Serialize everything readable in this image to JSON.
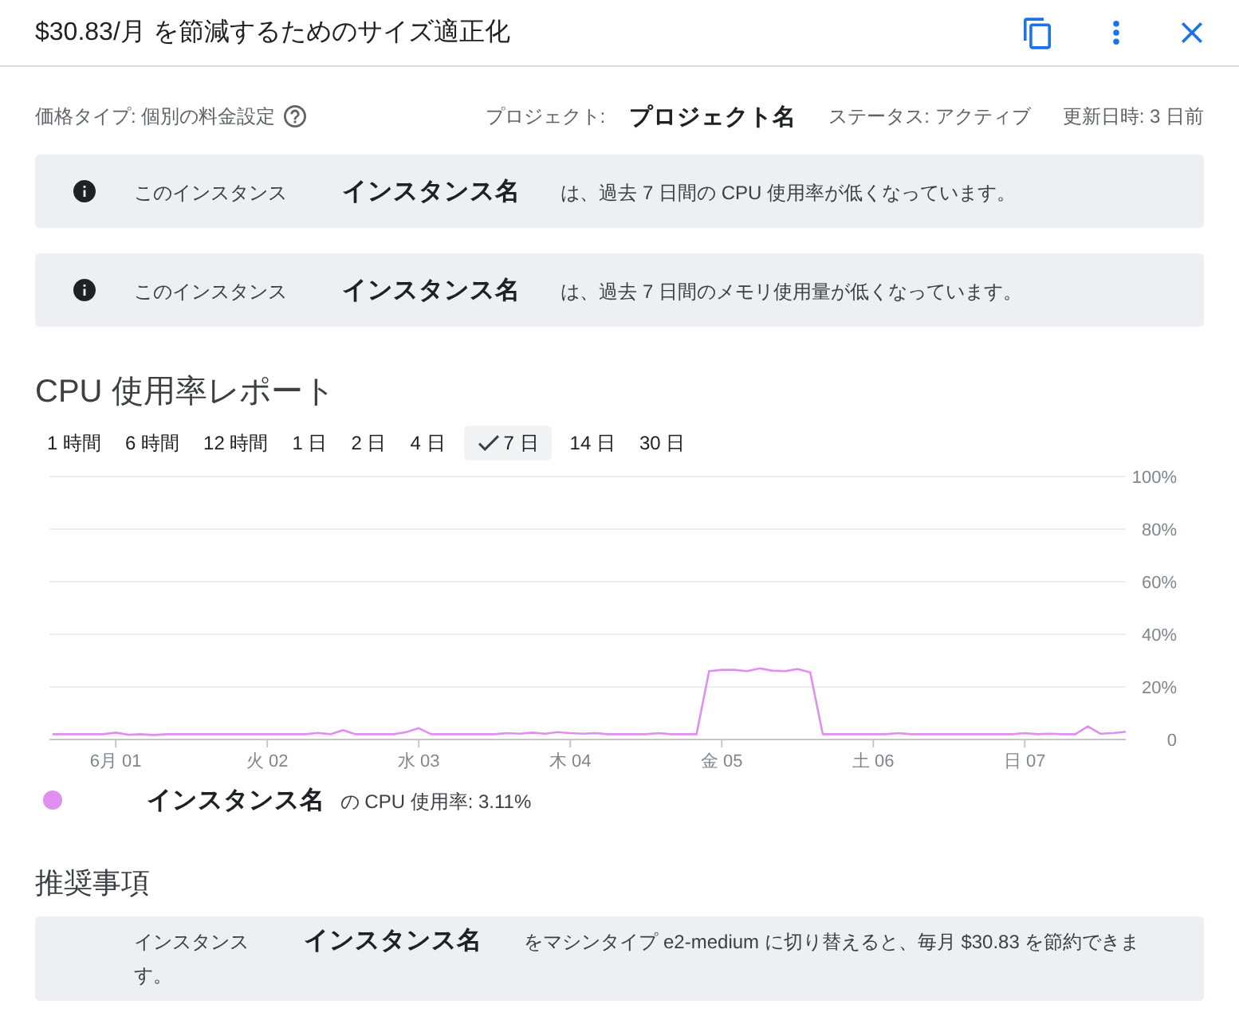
{
  "header": {
    "title": "$30.83/月 を節減するためのサイズ適正化"
  },
  "meta": {
    "pricing_type": "価格タイプ: 個別の料金設定",
    "project_label": "プロジェクト:",
    "project_name": "プロジェクト名",
    "status": "ステータス: アクティブ",
    "updated": "更新日時: 3 日前"
  },
  "alerts": [
    {
      "text": "このインスタンス **インスタンス名** は、過去 7 日間の CPU 使用率が低くなっています。"
    },
    {
      "text": "このインスタンス **インスタンス名** は、過去 7 日間のメモリ使用量が低くなっています。"
    }
  ],
  "cpu_report": {
    "title": "CPU 使用率レポート",
    "ranges": [
      {
        "label": "1 時間",
        "selected": false
      },
      {
        "label": "6 時間",
        "selected": false
      },
      {
        "label": "12 時間",
        "selected": false
      },
      {
        "label": "1 日",
        "selected": false
      },
      {
        "label": "2 日",
        "selected": false
      },
      {
        "label": "4 日",
        "selected": false
      },
      {
        "label": "7 日",
        "selected": true
      },
      {
        "label": "14 日",
        "selected": false
      },
      {
        "label": "30 日",
        "selected": false
      }
    ],
    "chart_data": {
      "type": "line",
      "categories": [
        null,
        null,
        null,
        null,
        null,
        "6月 01",
        null,
        null,
        null,
        null,
        null,
        null,
        null,
        null,
        null,
        null,
        null,
        "火 02",
        null,
        null,
        null,
        null,
        null,
        null,
        null,
        null,
        null,
        null,
        null,
        "水 03",
        null,
        null,
        null,
        null,
        null,
        null,
        null,
        null,
        null,
        null,
        null,
        "木 04",
        null,
        null,
        null,
        null,
        null,
        null,
        null,
        null,
        null,
        null,
        null,
        "金 05",
        null,
        null,
        null,
        null,
        null,
        null,
        null,
        null,
        null,
        null,
        null,
        "土 06",
        null,
        null,
        null,
        null,
        null,
        null,
        null,
        null,
        null,
        null,
        null,
        "日 07",
        null,
        null,
        null,
        null,
        null,
        null,
        null,
        null
      ],
      "series": [
        {
          "name": "インスタンス名",
          "color": "#e08ef0",
          "values": [
            2,
            2,
            2,
            2,
            2,
            2.6,
            1.8,
            2,
            1.7,
            2,
            2,
            2,
            2,
            2,
            2,
            2,
            2,
            2,
            2,
            2,
            2,
            2.5,
            2,
            3.6,
            2,
            2,
            2,
            2,
            2.8,
            4.3,
            2,
            2,
            2,
            2,
            2,
            2,
            2.4,
            2.2,
            2.6,
            2.2,
            2.8,
            2.4,
            2.2,
            2.4,
            2,
            2,
            2,
            2,
            2.4,
            2,
            2,
            2,
            26,
            26.5,
            26.5,
            26,
            27,
            26.2,
            26,
            26.8,
            25.5,
            2,
            2,
            2,
            2,
            2,
            2,
            2.4,
            2,
            2,
            2,
            2,
            2,
            2,
            2,
            2,
            2,
            2.4,
            2,
            2.2,
            2,
            2,
            5,
            2.2,
            2.4,
            3
          ]
        }
      ],
      "ylim": [
        0,
        100
      ],
      "yticks": [
        {
          "value": 0,
          "label": "0"
        },
        {
          "value": 20,
          "label": "20%"
        },
        {
          "value": 40,
          "label": "40%"
        },
        {
          "value": 60,
          "label": "60%"
        },
        {
          "value": 80,
          "label": "80%"
        },
        {
          "value": 100,
          "label": "100%"
        }
      ],
      "grid": true
    },
    "legend_text": "の CPU 使用率: 3.11%"
  },
  "recommendations": {
    "title": "推奨事項",
    "items": [
      {
        "text": "インスタンス **インスタンス名** をマシンタイプ e2-medium に切り替えると、毎月 $30.83 を節約できます。"
      }
    ]
  }
}
